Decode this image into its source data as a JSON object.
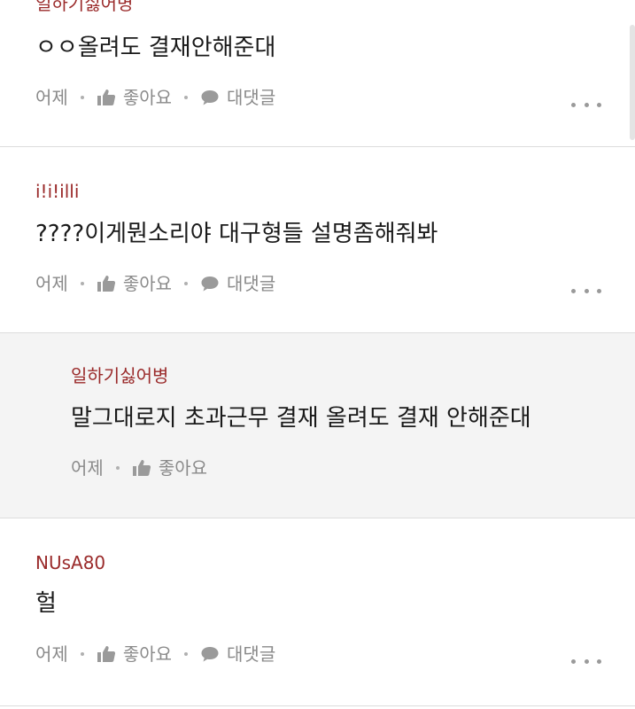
{
  "comments": [
    {
      "author": "일하기싫어병",
      "content": "ㅇㅇ올려도 결재안해준대",
      "time": "어제",
      "like_label": "좋아요",
      "reply_label": "대댓글"
    },
    {
      "author": "i!i!illi",
      "content": "????이게뭔소리야  대구형들 설명좀해줘봐",
      "time": "어제",
      "like_label": "좋아요",
      "reply_label": "대댓글"
    },
    {
      "author": "일하기싫어병",
      "content": "말그대로지 초과근무 결재 올려도 결재 안해준대",
      "time": "어제",
      "like_label": "좋아요"
    },
    {
      "author": "NUsA80",
      "content": "헐",
      "time": "어제",
      "like_label": "좋아요",
      "reply_label": "대댓글"
    }
  ],
  "icons": {
    "like": "thumbs-up-icon",
    "reply": "speech-bubble-icon",
    "more": "more-options-icon"
  },
  "colors": {
    "author": "#9a2a2a",
    "content": "#1a1a1a",
    "meta": "#8a8a8a",
    "reply_background": "#f4f4f4",
    "divider": "#dcdcdc"
  }
}
